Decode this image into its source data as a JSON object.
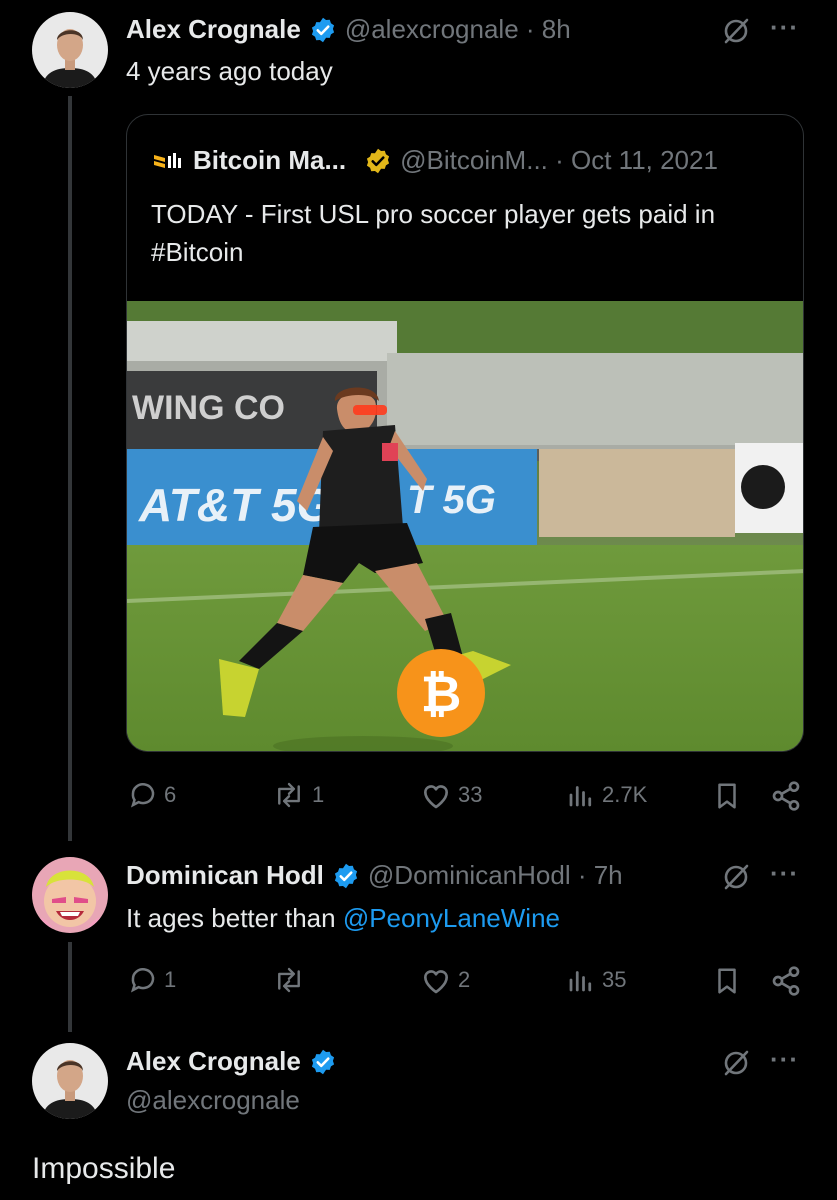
{
  "tweet1": {
    "author_name": "Alex Crognale",
    "handle_time": "@alexcrognale · 8h",
    "text": "4 years ago today",
    "quote": {
      "author_name": "Bitcoin Ma...",
      "handle_date": "@BitcoinM... · Oct 11, 2021",
      "text": "TODAY - First USL pro soccer player gets paid in #Bitcoin",
      "image_banner_text": "AT&T 5G",
      "image_banner_text_2": "T 5G",
      "image_stand_text": "WING CO"
    },
    "stats": {
      "replies": "6",
      "reposts": "1",
      "likes": "33",
      "views": "2.7K"
    }
  },
  "tweet2": {
    "author_name": "Dominican Hodl",
    "handle_time": "@DominicanHodl · 7h",
    "text_prefix": "It ages better than ",
    "mention": "@PeonyLaneWine",
    "stats": {
      "replies": "1",
      "reposts": "",
      "likes": "2",
      "views": "35"
    }
  },
  "tweet3": {
    "author_name": "Alex Crognale",
    "handle": "@alexcrognale",
    "text": "Impossible"
  },
  "icons": {
    "more": "···",
    "bitcoin_symbol": "₿",
    "grok": "grok-icon",
    "verified": "verified-badge-icon"
  },
  "colors": {
    "background": "#000000",
    "text": "#e7e9ea",
    "secondary": "#71767b",
    "verified_blue": "#1d9bf0",
    "verified_gold": "#e2b719",
    "bitcoin_orange": "#f7931a"
  }
}
